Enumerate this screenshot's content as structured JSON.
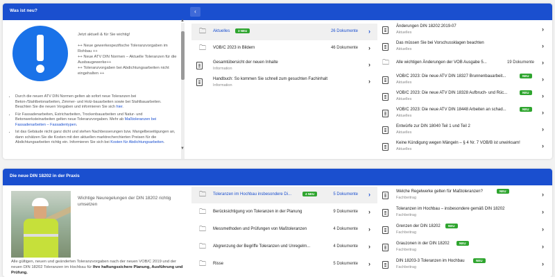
{
  "panel1": {
    "title": "Was ist neu?",
    "left": {
      "intro": "Jetzt aktuell & für Sie wichtig!",
      "lines": [
        "++ Neue gewerkespezifische Toleranzvorgaben im Rohbau ++",
        "++ Neue ATV DIN Normen – Aktuelle Toleranzen für die Ausbaugewerke++",
        "++ Toleranzvorgaben bei Abdichtungsarbeiten nicht eingehalten ++"
      ],
      "bullets": [
        {
          "text": "Durch die neuen ATV DIN Normen gelten ab sofort neue Toleranzen bei Beton-/Stahlbetonarbeiten, Zimmer- und Holz-bauarbeiten sowie bei Stahlbauarbeiten. Beachten Sie die neuen Vorgaben und informieren Sie sich ",
          "link": "hier",
          "tail": "."
        },
        {
          "text": "Für Fassadenarbeiten, Estricharbeiten, Trockenbauarbeiten und Natur- und Betonwerksteinarbeiten gelten neue Toleranzvorgaben. Mehr ab ",
          "link": "Maßtoleranzen bei Fassadenarbeiten – Fassadentypen",
          "tail": "."
        },
        {
          "text": "Ist das Gebäude nicht ganz dicht und stehen Nachbesserungen bzw. Mangelbeseitigungen an, dann schätzen Sie die Kosten mit den aktuellen marktrecherchierten Preisen für die Abdichtungsarbeiten richtig ein. Informieren Sie sich bei ",
          "link": "Kosten für Abdichtungsarbeiten",
          "tail": "."
        }
      ]
    },
    "middle": [
      {
        "type": "folder",
        "title": "Aktuelles",
        "badge": "3 NEU",
        "count": "26 Dokumente",
        "active": true
      },
      {
        "type": "folder",
        "title": "VOB/C 2023 in Bildern",
        "count": "46 Dokumente"
      },
      {
        "type": "doc",
        "title": "Gesamtübersicht der neuen Inhalte",
        "sub": "Information"
      },
      {
        "type": "doc",
        "title": "Handbuch: So kommen Sie schnell zum gesuchten Fachinhalt",
        "sub": "Information"
      }
    ],
    "right": [
      {
        "type": "doc",
        "title": "Änderungen DIN 18202:2019-07",
        "sub": "Aktuelles"
      },
      {
        "type": "doc",
        "title": "Das müssen Sie bei Vorschussklagen beachten",
        "sub": "Aktuelles"
      },
      {
        "type": "folder",
        "title": "Alle wichtigen Änderungen der VOB Ausgabe 5...",
        "count": "19 Dokumente"
      },
      {
        "type": "doc",
        "title": "VOB/C 2023: Die neue ATV DIN 18327 Brunnenbauarbeit...",
        "sub": "Aktuelles",
        "badge": "NEU"
      },
      {
        "type": "doc",
        "title": "VOB/C 2023: Die neue ATV DIN 18328 Aufbruch- und Rüc...",
        "sub": "Aktuelles",
        "badge": "NEU"
      },
      {
        "type": "doc",
        "title": "VOB/C 2023: Die neue ATV DIN 18448 Arbeiten an schad...",
        "sub": "Aktuelles",
        "badge": "NEU"
      },
      {
        "type": "doc",
        "title": "Entwürfe zur DIN 18040 Teil 1 und Teil 2",
        "sub": "Aktuelles"
      },
      {
        "type": "doc",
        "title": "Keine Kündigung wegen Mängeln – § 4 Nr. 7 VOB/B ist unwirksam!",
        "sub": "Aktuelles"
      }
    ]
  },
  "panel2": {
    "title": "Die neue DIN 18202 in der Praxis",
    "left": {
      "heading": "Wichtige Neuregelungen der DIN 18202 richtig umsetzen",
      "text": "Alle gültigen, neuen und geänderten Toleranzvorgaben nach der neuen VOB/C 2019 und der neuen DIN 18202 Toleranzen im Hochbau für ",
      "bold": "Ihre haftungssichere Planung, Ausführung und Prüfung."
    },
    "middle": [
      {
        "type": "folder",
        "title": "Toleranzen im Hochbau insbesondere Di...",
        "badge": "4 NEU",
        "count": "5 Dokumente",
        "active": true
      },
      {
        "type": "folder",
        "title": "Berücksichtigung von Toleranzen in der Planung",
        "count": "9 Dokumente"
      },
      {
        "type": "folder",
        "title": "Messmethoden und Prüfungen von Maßtoleranzen",
        "count": "4 Dokumente"
      },
      {
        "type": "folder",
        "title": "Abgrenzung der Begriffe Toleranzen und Unregelm...",
        "count": "4 Dokumente"
      },
      {
        "type": "folder",
        "title": "Risse",
        "count": "5 Dokumente"
      }
    ],
    "right": [
      {
        "type": "doc",
        "title": "Welche Regelwerke gelten für Maßtoleranzen?",
        "sub": "Fachbeitrag",
        "badge": "NEU"
      },
      {
        "type": "doc",
        "title": "Toleranzen im Hochbau – insbesondere gemäß DIN 18202",
        "sub": "Fachbeitrag"
      },
      {
        "type": "doc",
        "title": "Grenzen der DIN 18202",
        "sub": "Fachbeitrag",
        "badge": "NEU"
      },
      {
        "type": "doc",
        "title": "Grauzonen in der DIN 18202",
        "sub": "Fachbeitrag",
        "badge": "NEU"
      },
      {
        "type": "doc",
        "title": "DIN 18203-3 Toleranzen im Hochbau",
        "sub": "Fachbeitrag",
        "badge": "NEU"
      }
    ]
  },
  "colors": {
    "accent": "#1a4fcf",
    "badge": "#2fa52f",
    "info_icon": "#1a72e8"
  }
}
